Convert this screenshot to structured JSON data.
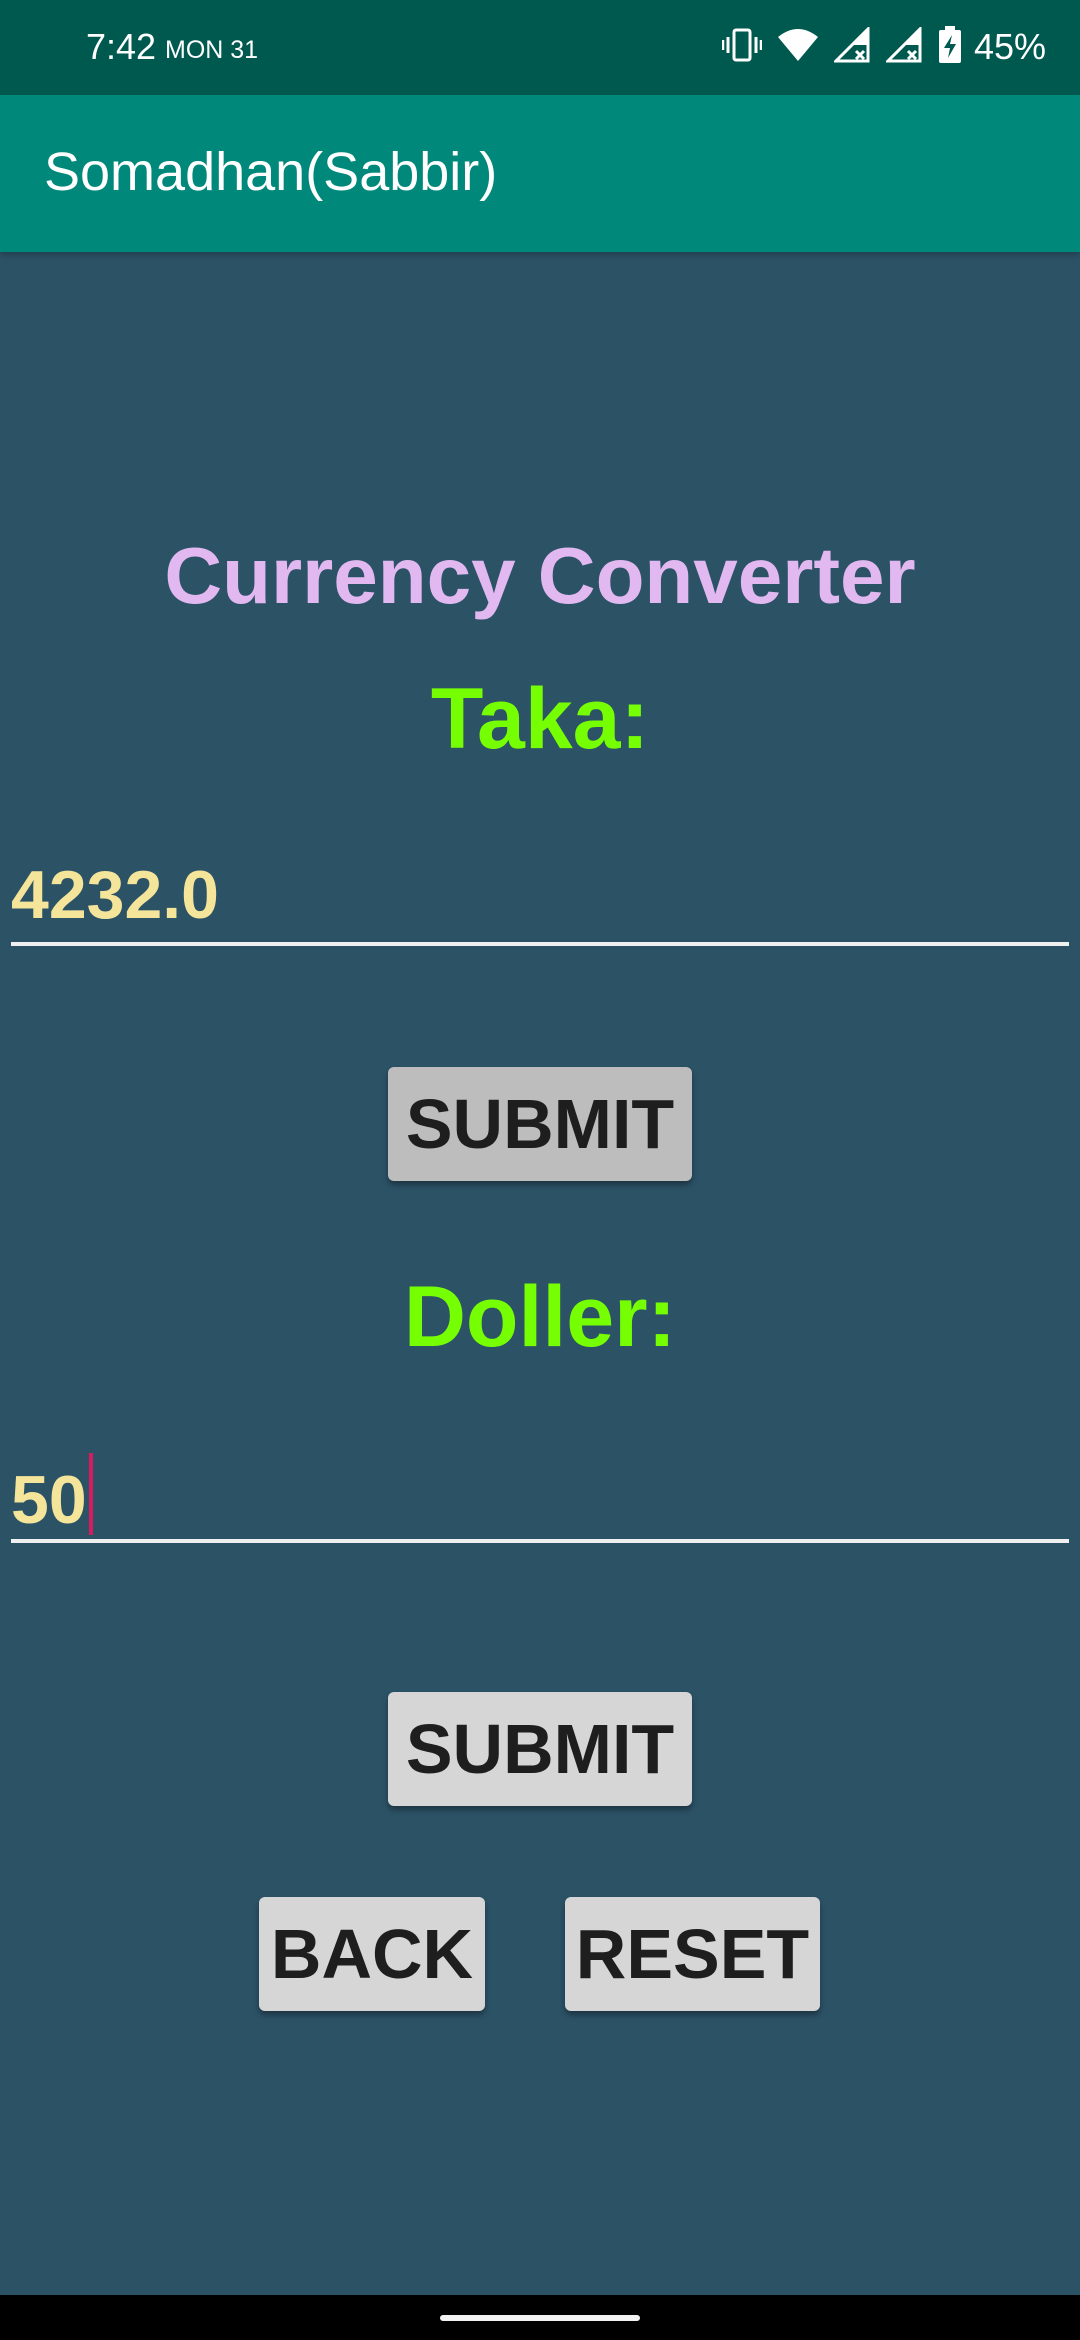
{
  "status_bar": {
    "time": "7:42",
    "day": "MON 31",
    "battery": "45%",
    "icons": [
      "vibrate-icon",
      "wifi-icon",
      "signal-icon",
      "signal-icon",
      "battery-charging-icon"
    ]
  },
  "app_bar": {
    "title": "Somadhan(Sabbir)",
    "color": "#00897b"
  },
  "main": {
    "heading": "Currency Converter",
    "taka_label": "Taka:",
    "taka_value": "4232.0",
    "submit_taka_label": "SUBMIT",
    "doller_label": "Doller:",
    "doller_value": "50",
    "submit_doller_label": "SUBMIT",
    "back_label": "BACK",
    "reset_label": "RESET"
  },
  "colors": {
    "background": "#2c5266",
    "heading": "#e1b8f0",
    "label": "#76ff03",
    "value": "#f4e59a",
    "cursor": "#d81b60"
  }
}
